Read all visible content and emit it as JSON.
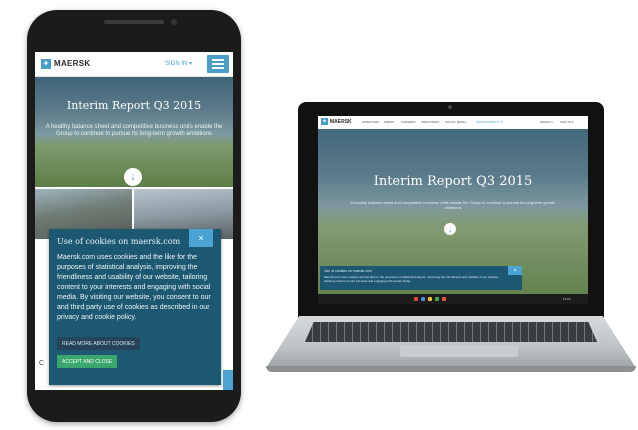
{
  "brand": {
    "name": "MAERSK",
    "accent": "#4a9ec9",
    "cookie_bg": "#1d5873",
    "accept_green": "#3aa66d"
  },
  "mobile": {
    "header": {
      "signin_label": "SIGN IN ▾"
    },
    "hero": {
      "title": "Interim Report Q3 2015",
      "subtitle": "A healthy balance sheet and competitive business units enable the Group to continue to pursue its long-term growth ambitions"
    },
    "cookie": {
      "title": "Use of cookies on maersk.com",
      "close_label": "×",
      "body": "Maersk.com uses cookies and the like for the purposes of statistical analysis, improving the friendliness and usability of our website, tailoring content to your interests and engaging with social media. By visiting our website, you consent to our and third party use of cookies as described in our privacy and cookie policy.",
      "read_more_label": "READ MORE ABOUT COOKIES",
      "accept_label": "ACCEPT AND CLOSE"
    },
    "side_letter": "C"
  },
  "laptop": {
    "nav": [
      "INVESTORS",
      "PRESS",
      "CAREERS",
      "INDUSTRIES",
      "SOCIAL MEDIA",
      "SUSTAINABILITY ▾",
      "SEARCH",
      "SIGN IN ▾"
    ],
    "hero": {
      "title": "Interim Report Q3 2015",
      "subtitle": "A healthy balance sheet and competitive business units enable the Group to continue to pursue its long-term growth ambitions"
    },
    "cookie": {
      "title": "Use of cookies on maersk.com",
      "close_label": "×",
      "body": "Maersk.com uses cookies and the like for the purposes of statistical analysis, improving the friendliness and usability of our website, tailoring content to your interests and engaging with social media."
    },
    "taskbar_time": "12:00"
  }
}
